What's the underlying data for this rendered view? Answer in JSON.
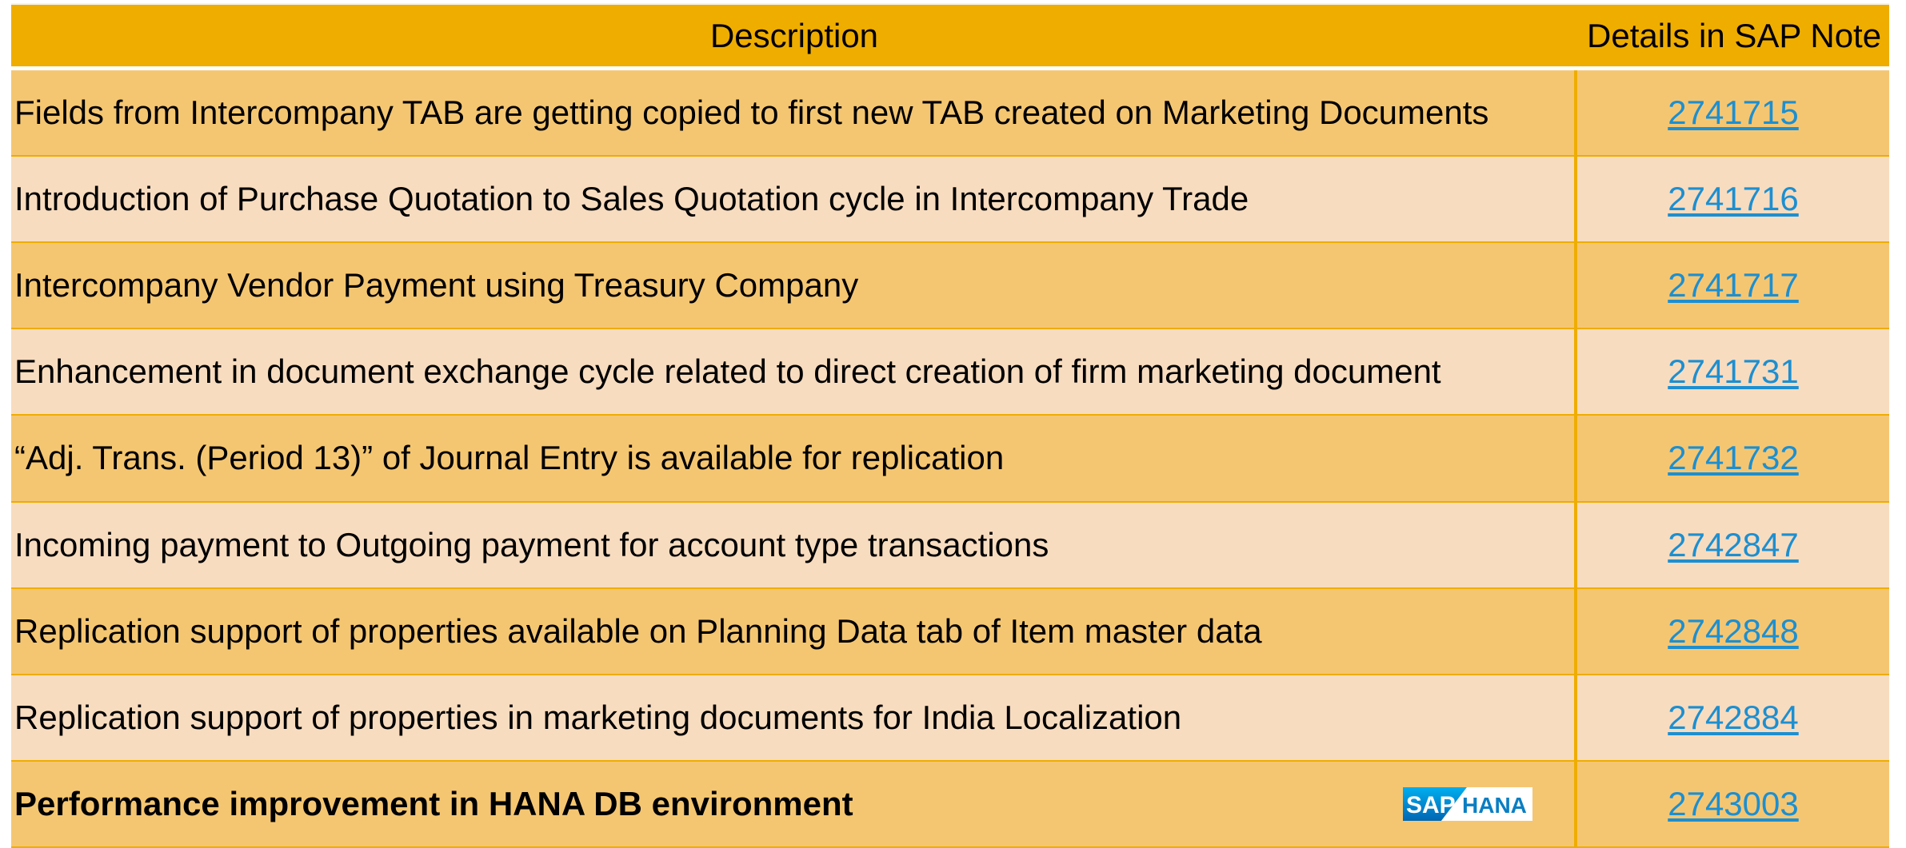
{
  "header": {
    "description": "Description",
    "details": "Details in SAP Note"
  },
  "rows": [
    {
      "description": "Fields from Intercompany TAB are getting copied to first new TAB created on Marketing Documents",
      "note": "2741715"
    },
    {
      "description": "Introduction of Purchase Quotation to Sales Quotation cycle in Intercompany Trade",
      "note": "2741716"
    },
    {
      "description": "Intercompany Vendor Payment using Treasury Company",
      "note": "2741717"
    },
    {
      "description": "Enhancement in document exchange cycle related to direct creation of firm marketing document",
      "note": "2741731"
    },
    {
      "description": "“Adj. Trans. (Period 13)” of Journal Entry is available for replication",
      "note": "2741732"
    },
    {
      "description": "Incoming payment to Outgoing payment for account type transactions",
      "note": "2742847"
    },
    {
      "description": "Replication support of properties available on Planning Data tab of Item master data",
      "note": "2742848"
    },
    {
      "description": "Replication support of properties in marketing documents for India Localization",
      "note": "2742884"
    },
    {
      "description": "Performance improvement in HANA DB environment",
      "note": "2743003"
    }
  ],
  "logo": {
    "sap": "SAP",
    "hana": "HANA"
  },
  "colors": {
    "header": "#efad00",
    "row_dark": "#f5c671",
    "row_light": "#f8dcbf",
    "link": "#1c8fd1"
  }
}
